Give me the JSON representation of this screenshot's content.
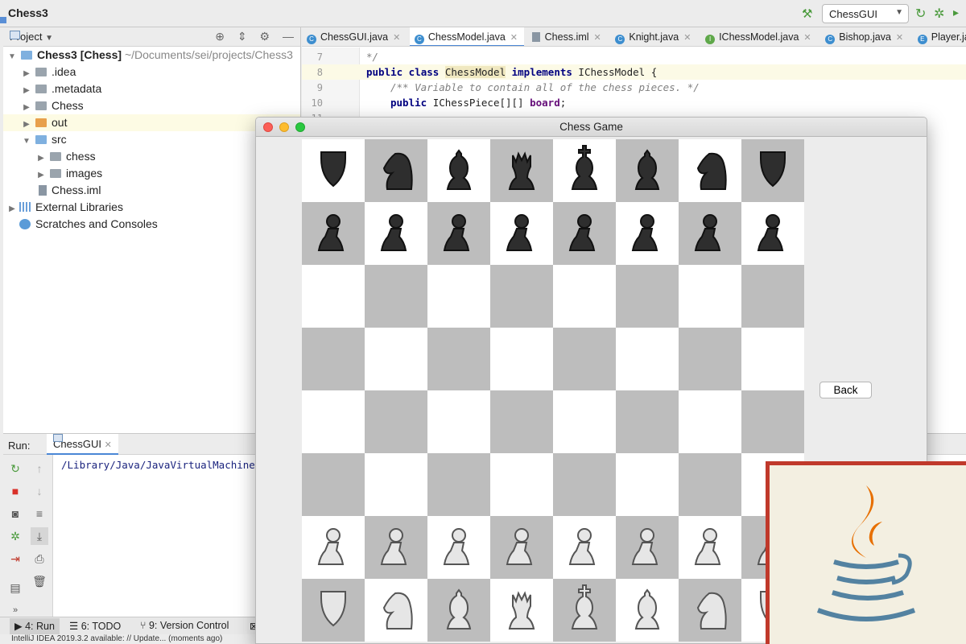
{
  "window": {
    "project_title": "Chess3",
    "run_config": "ChessGUI"
  },
  "project_panel": {
    "title": "Project",
    "tree": [
      {
        "label": "Chess3 [Chess]",
        "path": "~/Documents/sei/projects/Chess3"
      },
      {
        "label": ".idea"
      },
      {
        "label": ".metadata"
      },
      {
        "label": "Chess"
      },
      {
        "label": "out"
      },
      {
        "label": "src"
      },
      {
        "label": "chess"
      },
      {
        "label": "images"
      },
      {
        "label": "Chess.iml"
      },
      {
        "label": "External Libraries"
      },
      {
        "label": "Scratches and Consoles"
      }
    ]
  },
  "editor": {
    "tabs": [
      {
        "label": "ChessGUI.java"
      },
      {
        "label": "ChessModel.java"
      },
      {
        "label": "Chess.iml"
      },
      {
        "label": "Knight.java"
      },
      {
        "label": "IChessModel.java"
      },
      {
        "label": "Bishop.java"
      },
      {
        "label": "Player.java"
      }
    ],
    "lines": [
      {
        "num": "7",
        "text": "*/"
      },
      {
        "num": "8",
        "k1": "public class ",
        "name": "ChessModel",
        "k2": " implements ",
        "iface": "IChessModel {"
      },
      {
        "num": "9",
        "text": "/** Variable to contain all of the chess pieces. */"
      },
      {
        "num": "10",
        "k1": "public ",
        "type": "IChessPiece[][] ",
        "field": "board",
        "end": ";"
      },
      {
        "num": "11"
      }
    ]
  },
  "run_panel": {
    "label": "Run:",
    "tab": "ChessGUI",
    "output": "/Library/Java/JavaVirtualMachines"
  },
  "bottom_bar": {
    "run": "4: Run",
    "todo": "6: TODO",
    "vcs": "9: Version Control"
  },
  "status": "IntelliJ IDEA 2019.3.2 available: // Update... (moments ago)",
  "chess_window": {
    "title": "Chess Game",
    "back_label": "Back",
    "board": [
      [
        "bR",
        "bN",
        "bB",
        "bQ",
        "bK",
        "bB",
        "bN",
        "bR"
      ],
      [
        "bP",
        "bP",
        "bP",
        "bP",
        "bP",
        "bP",
        "bP",
        "bP"
      ],
      [
        "",
        "",
        "",
        "",
        "",
        "",
        "",
        ""
      ],
      [
        "",
        "",
        "",
        "",
        "",
        "",
        "",
        ""
      ],
      [
        "",
        "",
        "",
        "",
        "",
        "",
        "",
        ""
      ],
      [
        "",
        "",
        "",
        "",
        "",
        "",
        "",
        ""
      ],
      [
        "wP",
        "wP",
        "wP",
        "wP",
        "wP",
        "wP",
        "wP",
        "wP"
      ],
      [
        "wR",
        "wN",
        "wB",
        "wQ",
        "wK",
        "wB",
        "wN",
        "wR"
      ]
    ],
    "colors": {
      "dark_square": "#bdbdbd",
      "light_square": "#ffffff",
      "black_piece": "#2e2e2e",
      "white_piece": "#e6e6e6"
    }
  },
  "logo": {
    "name": "java-logo",
    "colors": {
      "flame": "#e76f00",
      "cup": "#5382a1",
      "border": "#c0392b"
    }
  }
}
